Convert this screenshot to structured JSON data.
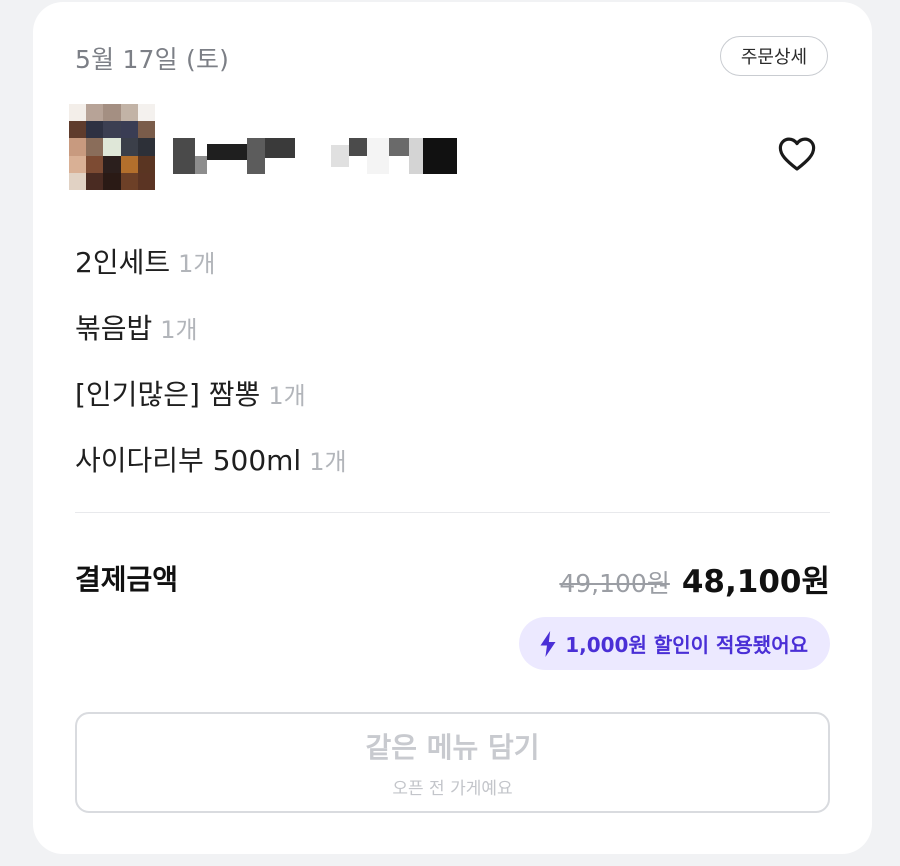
{
  "order": {
    "date": "5월 17일 (토)",
    "detail_label": "주문상세"
  },
  "store": {
    "thumbnail_icon": "store-thumbnail-pixelated",
    "name_icon": "store-name-redacted",
    "favorite_icon": "heart-outline-icon"
  },
  "items": [
    {
      "name": "2인세트",
      "qty": "1개"
    },
    {
      "name": "볶음밥",
      "qty": "1개"
    },
    {
      "name": "[인기많은] 짬뽕",
      "qty": "1개"
    },
    {
      "name": "사이다리부 500ml",
      "qty": "1개"
    }
  ],
  "payment": {
    "label": "결제금액",
    "original_price": "49,100원",
    "final_price": "48,100원",
    "discount_text": "1,000원 할인이 적용됐어요",
    "discount_icon": "lightning-icon"
  },
  "reorder": {
    "title": "같은 메뉴 담기",
    "subtitle": "오픈 전 가게예요"
  },
  "colors": {
    "accent": "#4a2fd6",
    "badge_bg": "#ece9ff",
    "muted": "#b2b5ba"
  }
}
